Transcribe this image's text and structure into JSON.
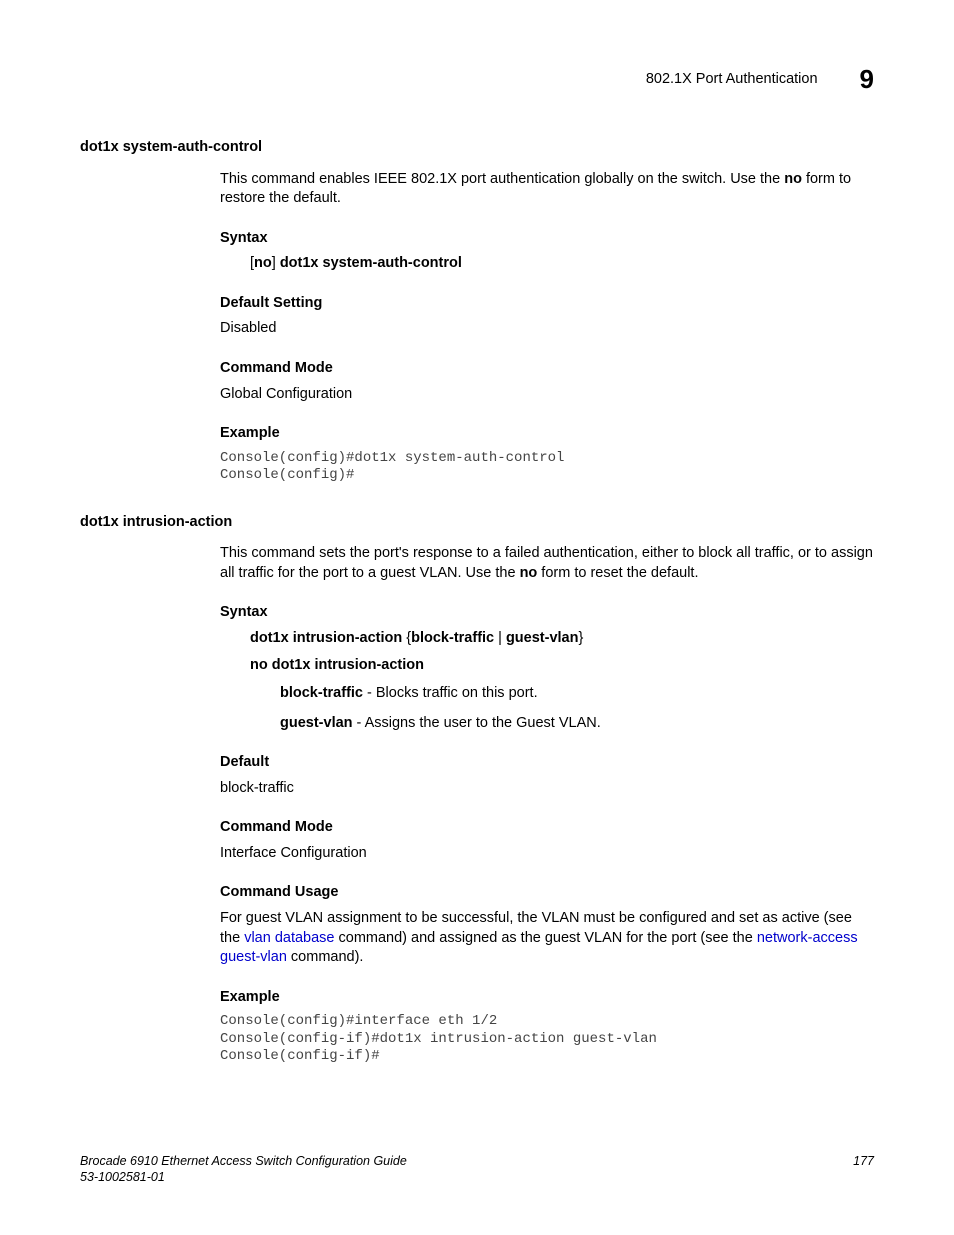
{
  "header": {
    "title": "802.1X Port Authentication",
    "chapter": "9"
  },
  "cmd1": {
    "name": "dot1x system-auth-control",
    "desc_1": "This command enables IEEE 802.1X port authentication globally on the switch. Use the ",
    "desc_no": "no",
    "desc_2": " form to restore the default.",
    "syntax_h": "Syntax",
    "syntax_l1": "[",
    "syntax_l2": "no",
    "syntax_l3": "] ",
    "syntax_l4": "dot1x system-auth-control",
    "default_h": "Default Setting",
    "default_v": "Disabled",
    "mode_h": "Command Mode",
    "mode_v": "Global Configuration",
    "example_h": "Example",
    "example_code": "Console(config)#dot1x system-auth-control\nConsole(config)#"
  },
  "cmd2": {
    "name": "dot1x intrusion-action",
    "desc_1": "This command sets the port's response to a failed authentication, either to block all traffic, or to assign all traffic for the port to a guest VLAN. Use the ",
    "desc_no": "no",
    "desc_2": " form to reset the default.",
    "syntax_h": "Syntax",
    "syntax_line1_a": "dot1x intrusion-action",
    "syntax_line1_b": " {",
    "syntax_line1_c": "block-traffic",
    "syntax_line1_d": " | ",
    "syntax_line1_e": "guest-vlan",
    "syntax_line1_f": "}",
    "syntax_line2": "no dot1x intrusion-action",
    "opt1_term": "block-traffic",
    "opt1_desc": " - Blocks traffic on this port.",
    "opt2_term": "guest-vlan",
    "opt2_desc": " - Assigns the user to the Guest VLAN.",
    "default_h": "Default",
    "default_v": "block-traffic",
    "mode_h": "Command Mode",
    "mode_v": "Interface Configuration",
    "usage_h": "Command Usage",
    "usage_1": "For guest VLAN assignment to be successful, the VLAN must be configured and set as active (see the ",
    "usage_link1": "vlan database",
    "usage_2": " command) and assigned as the guest VLAN for the port (see the ",
    "usage_link2": "network-access guest-vlan",
    "usage_3": " command).",
    "example_h": "Example",
    "example_code": "Console(config)#interface eth 1/2\nConsole(config-if)#dot1x intrusion-action guest-vlan\nConsole(config-if)#"
  },
  "footer": {
    "line1": "Brocade 6910 Ethernet Access Switch Configuration Guide",
    "line2": "53-1002581-01",
    "page": "177"
  }
}
